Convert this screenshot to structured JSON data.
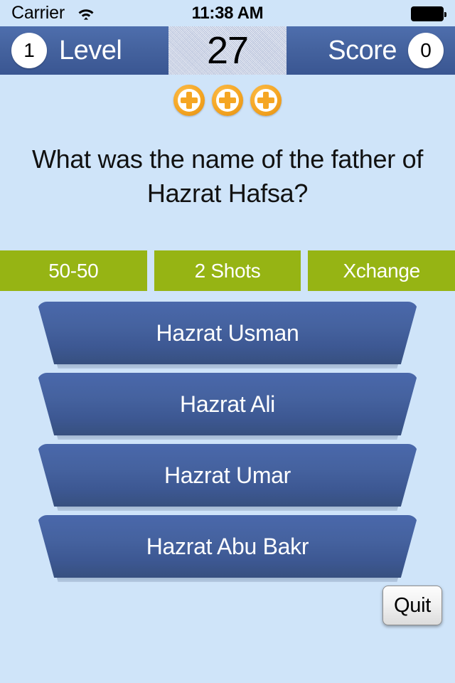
{
  "status_bar": {
    "carrier": "Carrier",
    "wifi_icon": "wifi-icon",
    "time": "11:38 AM",
    "battery_icon": "battery-full-icon"
  },
  "header": {
    "level_value": "1",
    "level_label": "Level",
    "timer_value": "27",
    "score_label": "Score",
    "score_value": "0"
  },
  "lives": {
    "count": 3,
    "icon": "coin-plus-icon",
    "items": [
      {
        "icon": "coin-plus-icon"
      },
      {
        "icon": "coin-plus-icon"
      },
      {
        "icon": "coin-plus-icon"
      }
    ]
  },
  "question": {
    "text": "What was the name of the father of Hazrat Hafsa?"
  },
  "lifelines": [
    {
      "label": "50-50"
    },
    {
      "label": "2 Shots"
    },
    {
      "label": "Xchange"
    }
  ],
  "answers": [
    {
      "label": "Hazrat Usman"
    },
    {
      "label": "Hazrat Ali"
    },
    {
      "label": "Hazrat Umar"
    },
    {
      "label": "Hazrat Abu Bakr"
    }
  ],
  "quit": {
    "label": "Quit"
  },
  "colors": {
    "background": "#cfe4f9",
    "header_blue": "#45639f",
    "timer_panel": "#c9d2e6",
    "lifeline_green": "#96b414",
    "answer_blue": "#45629f",
    "coin_orange": "#f5a623",
    "quit_grey": "#f0f0f0"
  }
}
